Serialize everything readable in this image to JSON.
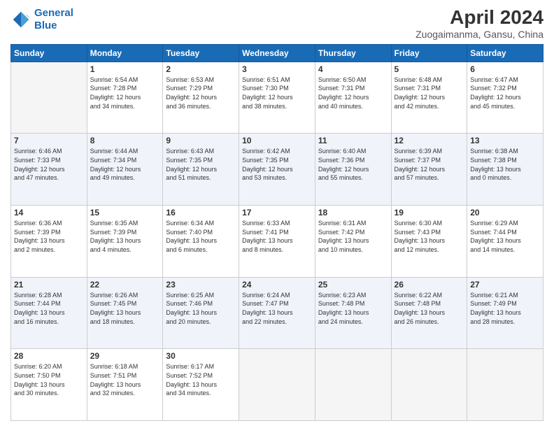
{
  "header": {
    "logo_line1": "General",
    "logo_line2": "Blue",
    "title": "April 2024",
    "subtitle": "Zuogaimanma, Gansu, China"
  },
  "days_of_week": [
    "Sunday",
    "Monday",
    "Tuesday",
    "Wednesday",
    "Thursday",
    "Friday",
    "Saturday"
  ],
  "weeks": [
    [
      {
        "day": "",
        "info": ""
      },
      {
        "day": "1",
        "info": "Sunrise: 6:54 AM\nSunset: 7:28 PM\nDaylight: 12 hours\nand 34 minutes."
      },
      {
        "day": "2",
        "info": "Sunrise: 6:53 AM\nSunset: 7:29 PM\nDaylight: 12 hours\nand 36 minutes."
      },
      {
        "day": "3",
        "info": "Sunrise: 6:51 AM\nSunset: 7:30 PM\nDaylight: 12 hours\nand 38 minutes."
      },
      {
        "day": "4",
        "info": "Sunrise: 6:50 AM\nSunset: 7:31 PM\nDaylight: 12 hours\nand 40 minutes."
      },
      {
        "day": "5",
        "info": "Sunrise: 6:48 AM\nSunset: 7:31 PM\nDaylight: 12 hours\nand 42 minutes."
      },
      {
        "day": "6",
        "info": "Sunrise: 6:47 AM\nSunset: 7:32 PM\nDaylight: 12 hours\nand 45 minutes."
      }
    ],
    [
      {
        "day": "7",
        "info": "Sunrise: 6:46 AM\nSunset: 7:33 PM\nDaylight: 12 hours\nand 47 minutes."
      },
      {
        "day": "8",
        "info": "Sunrise: 6:44 AM\nSunset: 7:34 PM\nDaylight: 12 hours\nand 49 minutes."
      },
      {
        "day": "9",
        "info": "Sunrise: 6:43 AM\nSunset: 7:35 PM\nDaylight: 12 hours\nand 51 minutes."
      },
      {
        "day": "10",
        "info": "Sunrise: 6:42 AM\nSunset: 7:35 PM\nDaylight: 12 hours\nand 53 minutes."
      },
      {
        "day": "11",
        "info": "Sunrise: 6:40 AM\nSunset: 7:36 PM\nDaylight: 12 hours\nand 55 minutes."
      },
      {
        "day": "12",
        "info": "Sunrise: 6:39 AM\nSunset: 7:37 PM\nDaylight: 12 hours\nand 57 minutes."
      },
      {
        "day": "13",
        "info": "Sunrise: 6:38 AM\nSunset: 7:38 PM\nDaylight: 13 hours\nand 0 minutes."
      }
    ],
    [
      {
        "day": "14",
        "info": "Sunrise: 6:36 AM\nSunset: 7:39 PM\nDaylight: 13 hours\nand 2 minutes."
      },
      {
        "day": "15",
        "info": "Sunrise: 6:35 AM\nSunset: 7:39 PM\nDaylight: 13 hours\nand 4 minutes."
      },
      {
        "day": "16",
        "info": "Sunrise: 6:34 AM\nSunset: 7:40 PM\nDaylight: 13 hours\nand 6 minutes."
      },
      {
        "day": "17",
        "info": "Sunrise: 6:33 AM\nSunset: 7:41 PM\nDaylight: 13 hours\nand 8 minutes."
      },
      {
        "day": "18",
        "info": "Sunrise: 6:31 AM\nSunset: 7:42 PM\nDaylight: 13 hours\nand 10 minutes."
      },
      {
        "day": "19",
        "info": "Sunrise: 6:30 AM\nSunset: 7:43 PM\nDaylight: 13 hours\nand 12 minutes."
      },
      {
        "day": "20",
        "info": "Sunrise: 6:29 AM\nSunset: 7:44 PM\nDaylight: 13 hours\nand 14 minutes."
      }
    ],
    [
      {
        "day": "21",
        "info": "Sunrise: 6:28 AM\nSunset: 7:44 PM\nDaylight: 13 hours\nand 16 minutes."
      },
      {
        "day": "22",
        "info": "Sunrise: 6:26 AM\nSunset: 7:45 PM\nDaylight: 13 hours\nand 18 minutes."
      },
      {
        "day": "23",
        "info": "Sunrise: 6:25 AM\nSunset: 7:46 PM\nDaylight: 13 hours\nand 20 minutes."
      },
      {
        "day": "24",
        "info": "Sunrise: 6:24 AM\nSunset: 7:47 PM\nDaylight: 13 hours\nand 22 minutes."
      },
      {
        "day": "25",
        "info": "Sunrise: 6:23 AM\nSunset: 7:48 PM\nDaylight: 13 hours\nand 24 minutes."
      },
      {
        "day": "26",
        "info": "Sunrise: 6:22 AM\nSunset: 7:48 PM\nDaylight: 13 hours\nand 26 minutes."
      },
      {
        "day": "27",
        "info": "Sunrise: 6:21 AM\nSunset: 7:49 PM\nDaylight: 13 hours\nand 28 minutes."
      }
    ],
    [
      {
        "day": "28",
        "info": "Sunrise: 6:20 AM\nSunset: 7:50 PM\nDaylight: 13 hours\nand 30 minutes."
      },
      {
        "day": "29",
        "info": "Sunrise: 6:18 AM\nSunset: 7:51 PM\nDaylight: 13 hours\nand 32 minutes."
      },
      {
        "day": "30",
        "info": "Sunrise: 6:17 AM\nSunset: 7:52 PM\nDaylight: 13 hours\nand 34 minutes."
      },
      {
        "day": "",
        "info": ""
      },
      {
        "day": "",
        "info": ""
      },
      {
        "day": "",
        "info": ""
      },
      {
        "day": "",
        "info": ""
      }
    ]
  ]
}
